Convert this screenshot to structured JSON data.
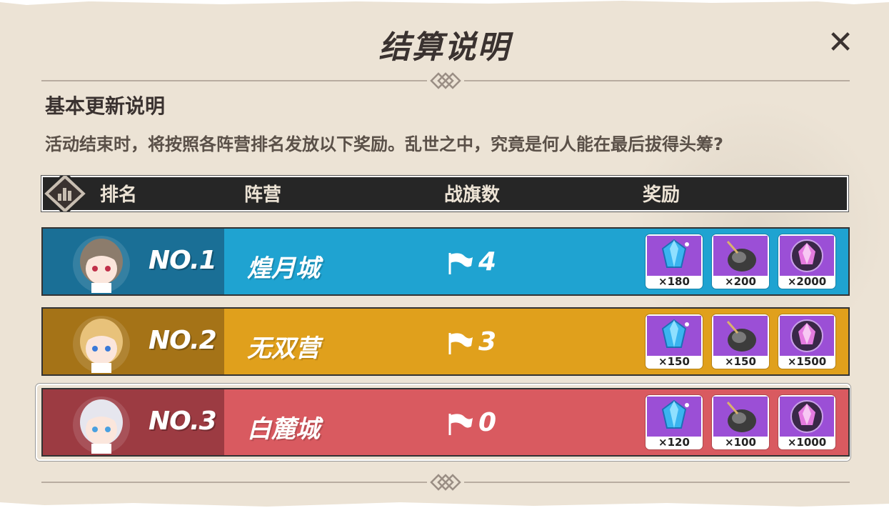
{
  "dialog": {
    "title": "结算说明",
    "close_icon": "close-icon",
    "section_title": "基本更新说明",
    "description": "活动结束时，将按照各阵营排名发放以下奖励。乱世之中，究竟是何人能在最后拔得头筹?"
  },
  "table": {
    "header_icon": "ranking-bars-icon",
    "headers": [
      "排名",
      "阵营",
      "战旗数",
      "奖励"
    ],
    "rows": [
      {
        "rank": "NO.1",
        "faction": "煌月城",
        "flags": "4",
        "color_left": "#1a6f96",
        "color_right": "#1fa3d1",
        "rewards": [
          {
            "icon": "crystal-icon",
            "count": "×180"
          },
          {
            "icon": "stigma-feather-icon",
            "count": "×200"
          },
          {
            "icon": "purple-orb-icon",
            "count": "×2000"
          }
        ]
      },
      {
        "rank": "NO.2",
        "faction": "无双营",
        "flags": "3",
        "color_left": "#a57317",
        "color_right": "#e0a01c",
        "rewards": [
          {
            "icon": "crystal-icon",
            "count": "×150"
          },
          {
            "icon": "stigma-feather-icon",
            "count": "×150"
          },
          {
            "icon": "purple-orb-icon",
            "count": "×1500"
          }
        ]
      },
      {
        "rank": "NO.3",
        "faction": "白麓城",
        "flags": "0",
        "color_left": "#9c3b42",
        "color_right": "#d95a60",
        "rewards": [
          {
            "icon": "crystal-icon",
            "count": "×120"
          },
          {
            "icon": "stigma-feather-icon",
            "count": "×100"
          },
          {
            "icon": "purple-orb-icon",
            "count": "×1000"
          }
        ]
      }
    ]
  }
}
